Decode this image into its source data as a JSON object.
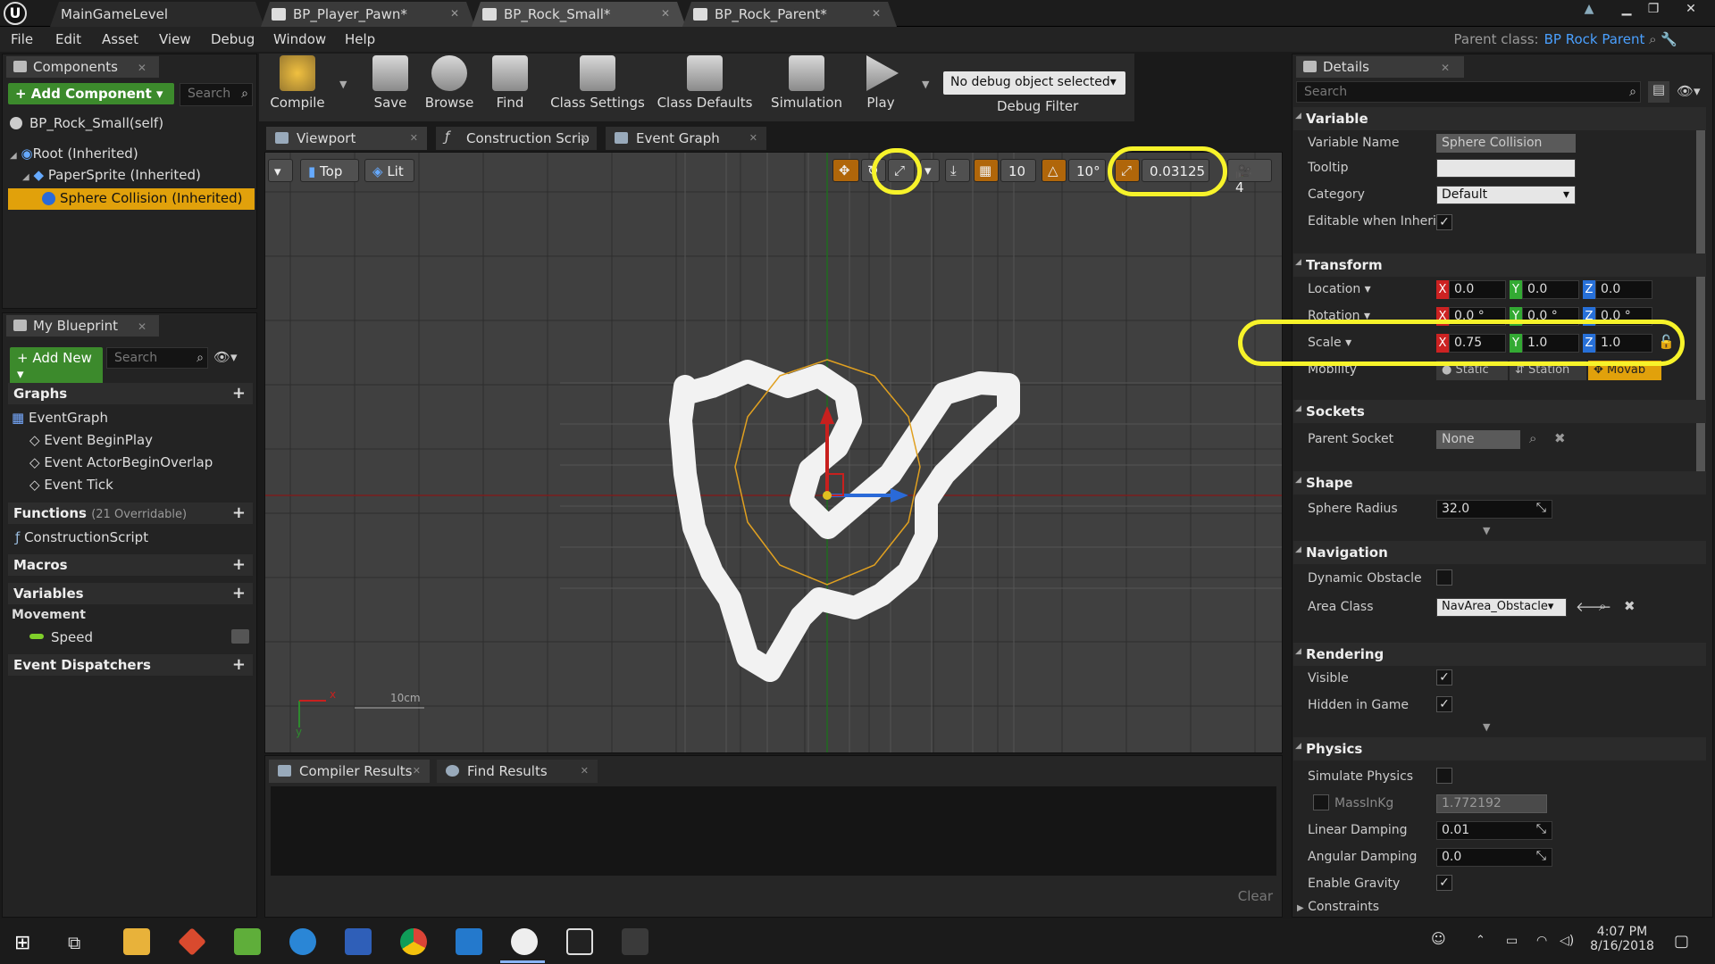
{
  "window_tabs": [
    "MainGameLevel",
    "BP_Player_Pawn*",
    "BP_Rock_Small*",
    "BP_Rock_Parent*"
  ],
  "menu": [
    "File",
    "Edit",
    "Asset",
    "View",
    "Debug",
    "Window",
    "Help"
  ],
  "parent_class": {
    "label": "Parent class:",
    "value": "BP Rock Parent"
  },
  "components": {
    "tab": "Components",
    "add_label": "+ Add Component ▾",
    "search_placeholder": "Search",
    "self": "BP_Rock_Small(self)",
    "tree": [
      "Root (Inherited)",
      "PaperSprite (Inherited)",
      "Sphere Collision (Inherited)"
    ]
  },
  "my_blueprint": {
    "tab": "My Blueprint",
    "add_new": "+ Add New ▾",
    "search_placeholder": "Search",
    "graphs": "Graphs",
    "event_graph": "EventGraph",
    "events": [
      "Event BeginPlay",
      "Event ActorBeginOverlap",
      "Event Tick"
    ],
    "functions": "Functions",
    "functions_sub": "(21 Overridable)",
    "construction": "ConstructionScript",
    "macros": "Macros",
    "variables": "Variables",
    "movement": "Movement",
    "speed": "Speed",
    "dispatchers": "Event Dispatchers"
  },
  "toolbar": {
    "buttons": [
      "Compile",
      "Save",
      "Browse",
      "Find",
      "Class Settings",
      "Class Defaults",
      "Simulation",
      "Play"
    ],
    "debug_select": "No debug object selected▾",
    "debug_filter": "Debug Filter"
  },
  "editor_tabs": [
    "Viewport",
    "Construction Scrip",
    "Event Graph"
  ],
  "viewport": {
    "view_mode": "Top",
    "lit": "Lit",
    "grid_snap": "10",
    "rot_snap": "10°",
    "scale_snap": "0.03125",
    "camera_speed": "4",
    "scale_bar": "10cm",
    "axis_x": "x",
    "axis_y": "y"
  },
  "bottom_tabs": [
    "Compiler Results",
    "Find Results"
  ],
  "clear": "Clear",
  "details": {
    "tab": "Details",
    "search_placeholder": "Search",
    "variable": {
      "title": "Variable",
      "name_label": "Variable Name",
      "name": "Sphere Collision",
      "tooltip_label": "Tooltip",
      "tooltip": "",
      "category_label": "Category",
      "category": "Default",
      "editable_label": "Editable when Inherit"
    },
    "transform": {
      "title": "Transform",
      "location_label": "Location ▾",
      "location": [
        "0.0",
        "0.0",
        "0.0"
      ],
      "rotation_label": "Rotation ▾",
      "rotation": [
        "0.0 °",
        "0.0 °",
        "0.0 °"
      ],
      "scale_label": "Scale ▾",
      "scale": [
        "0.75",
        "1.0",
        "1.0"
      ],
      "mobility_label": "Mobility",
      "mobility": [
        "Static",
        "Station",
        "Movab"
      ]
    },
    "sockets": {
      "title": "Sockets",
      "parent_label": "Parent Socket",
      "parent": "None"
    },
    "shape": {
      "title": "Shape",
      "radius_label": "Sphere Radius",
      "radius": "32.0"
    },
    "navigation": {
      "title": "Navigation",
      "dynamic_label": "Dynamic Obstacle",
      "area_label": "Area Class",
      "area": "NavArea_Obstacle▾"
    },
    "rendering": {
      "title": "Rendering",
      "visible_label": "Visible",
      "hidden_label": "Hidden in Game"
    },
    "physics": {
      "title": "Physics",
      "simulate_label": "Simulate Physics",
      "mass_label": "MassInKg",
      "mass": "1.772192",
      "linear_label": "Linear Damping",
      "linear": "0.01",
      "angular_label": "Angular Damping",
      "angular": "0.0",
      "gravity_label": "Enable Gravity",
      "constraints": "Constraints"
    }
  },
  "clock": {
    "time": "4:07 PM",
    "date": "8/16/2018"
  },
  "colors": {
    "accent": "#e1a10b",
    "highlight": "#f7f32a",
    "selection": "#e1a10b"
  }
}
